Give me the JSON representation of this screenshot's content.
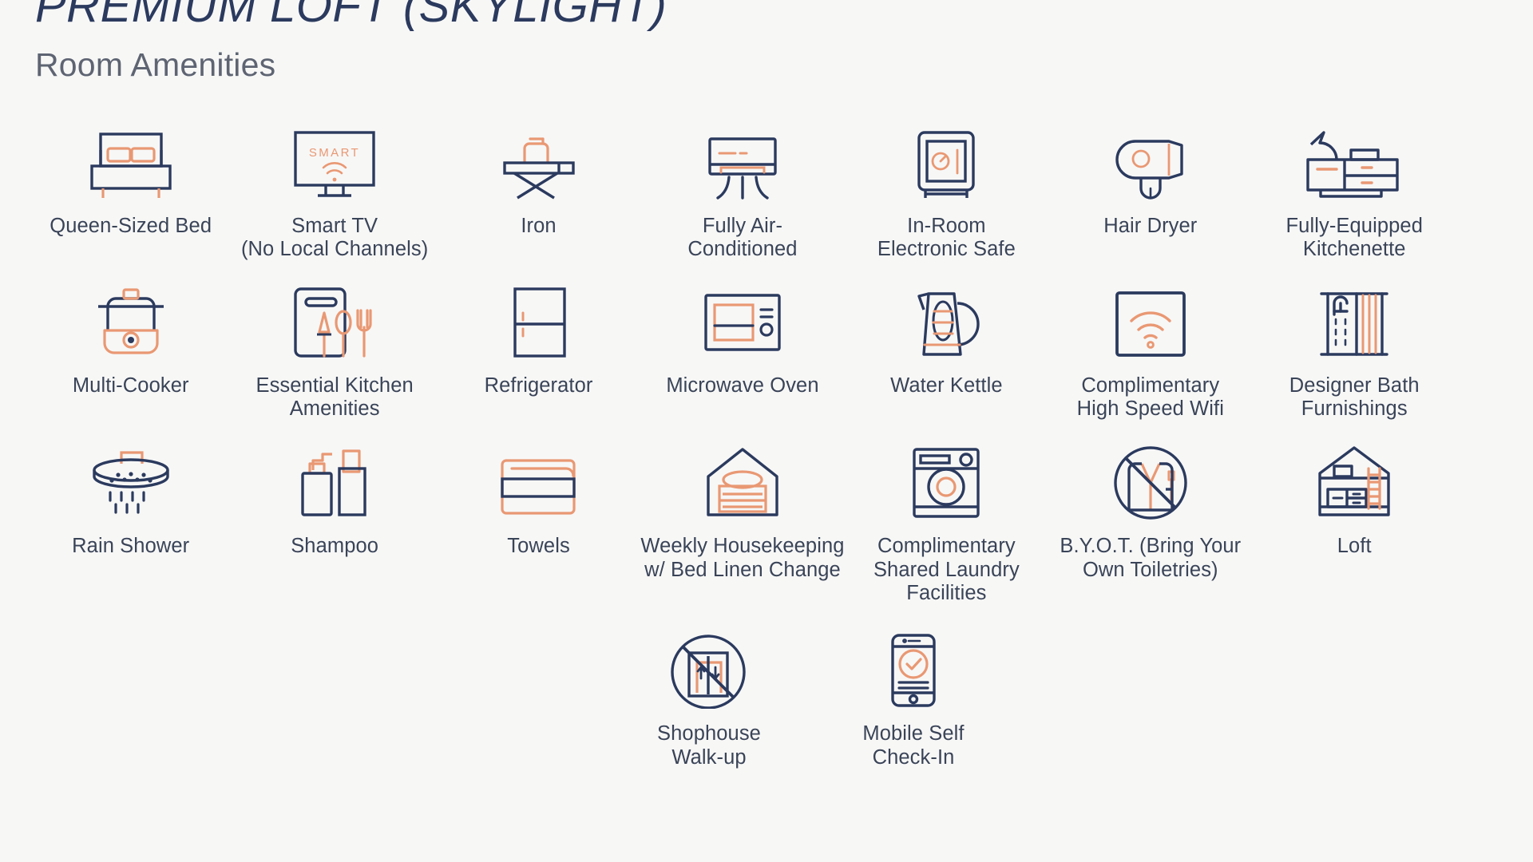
{
  "header": {
    "room_title": "PREMIUM LOFT (SKYLIGHT)",
    "section_title": "Room Amenities"
  },
  "colors": {
    "background": "#f7f7f6",
    "navy": "#2b3a5e",
    "navy_text": "#3a4458",
    "accent_orange": "#e99873",
    "accent_orange_light": "#eeae8f",
    "subtitle_gray": "#5e6472"
  },
  "amenities": {
    "rows": [
      [
        {
          "label": "Queen-Sized Bed",
          "icon": "bed-icon"
        },
        {
          "label": "Smart TV\n(No Local Channels)",
          "icon": "smart-tv-icon",
          "screen_text": "SMART"
        },
        {
          "label": "Iron",
          "icon": "iron-icon"
        },
        {
          "label": "Fully Air-\nConditioned",
          "icon": "air-conditioner-icon"
        },
        {
          "label": "In-Room\nElectronic Safe",
          "icon": "safe-icon"
        },
        {
          "label": "Hair Dryer",
          "icon": "hair-dryer-icon"
        },
        {
          "label": "Fully-Equipped\nKitchenette",
          "icon": "kitchenette-icon"
        }
      ],
      [
        {
          "label": "Multi-Cooker",
          "icon": "multi-cooker-icon"
        },
        {
          "label": "Essential Kitchen\nAmenities",
          "icon": "kitchen-utensils-icon"
        },
        {
          "label": "Refrigerator",
          "icon": "refrigerator-icon"
        },
        {
          "label": "Microwave Oven",
          "icon": "microwave-icon"
        },
        {
          "label": "Water Kettle",
          "icon": "kettle-icon"
        },
        {
          "label": "Complimentary\nHigh Speed Wifi",
          "icon": "wifi-icon"
        },
        {
          "label": "Designer Bath\nFurnishings",
          "icon": "bath-shower-curtain-icon"
        }
      ],
      [
        {
          "label": "Rain Shower",
          "icon": "rain-shower-icon"
        },
        {
          "label": "Shampoo",
          "icon": "shampoo-bottles-icon"
        },
        {
          "label": "Towels",
          "icon": "towels-icon"
        },
        {
          "label": "Weekly Housekeeping\nw/ Bed Linen Change",
          "icon": "housekeeping-linen-icon"
        },
        {
          "label": "Complimentary\nShared Laundry\nFacilities",
          "icon": "washing-machine-icon"
        },
        {
          "label": "B.Y.O.T. (Bring Your\nOwn Toiletries)",
          "icon": "no-toiletries-icon"
        },
        {
          "label": "Loft",
          "icon": "loft-icon"
        }
      ],
      [
        {
          "label": "Shophouse\nWalk-up",
          "icon": "no-elevator-icon"
        },
        {
          "label": "Mobile Self\nCheck-In",
          "icon": "mobile-checkin-icon"
        }
      ]
    ]
  }
}
